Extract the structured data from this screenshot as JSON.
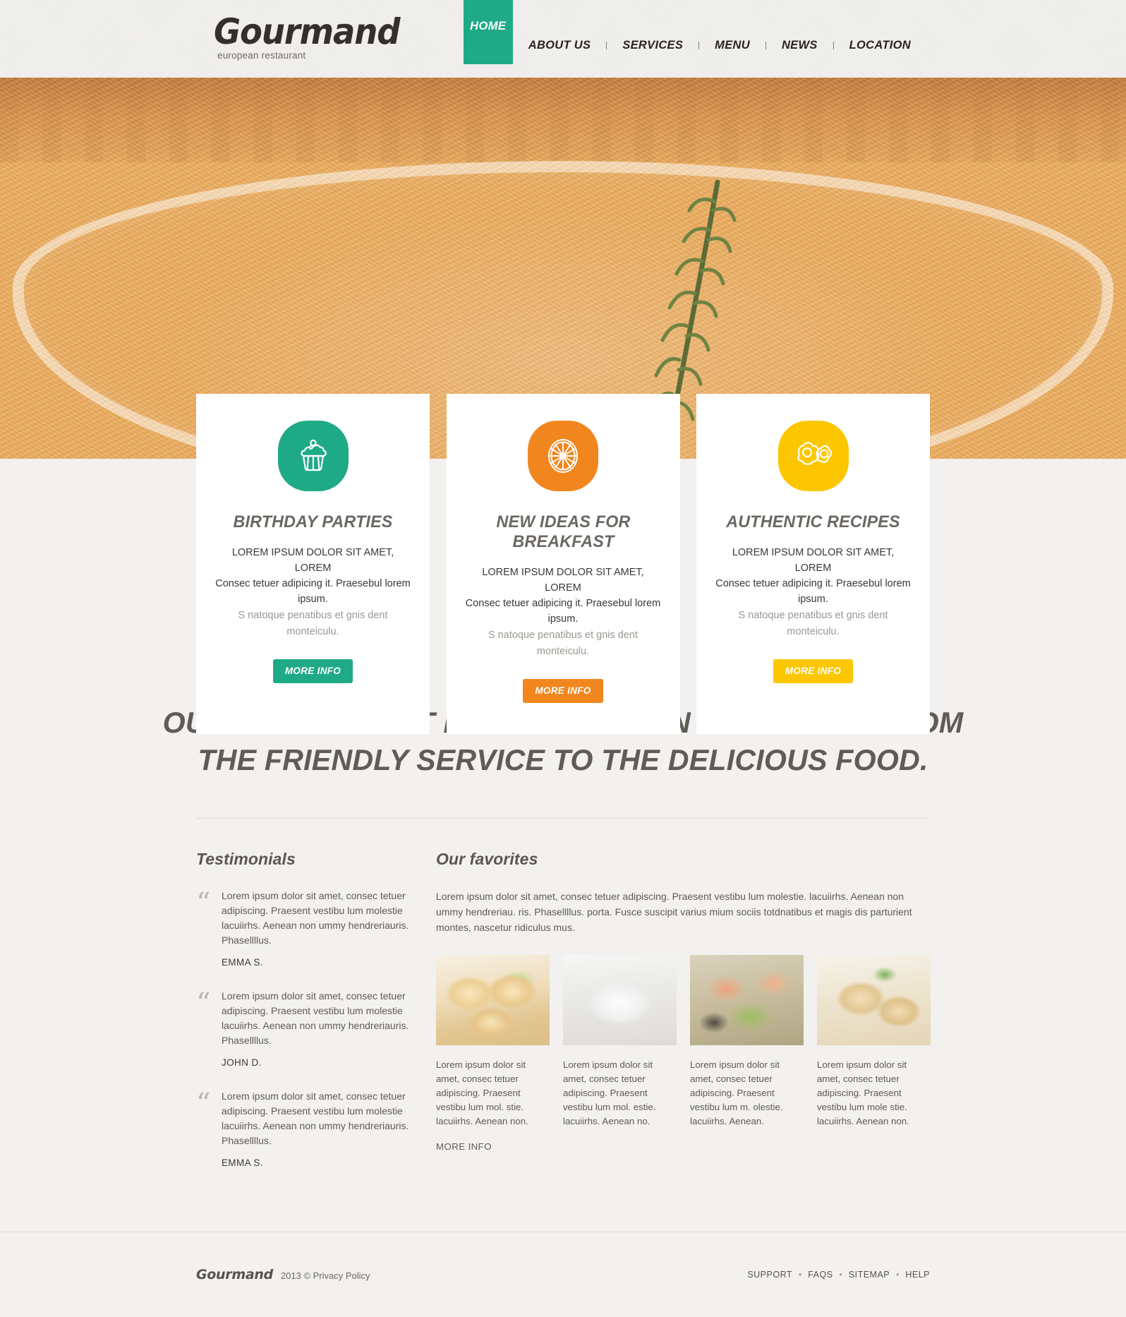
{
  "header": {
    "logo_title": "Gourmand",
    "logo_sub": "european restaurant",
    "nav": {
      "active": "HOME",
      "items": [
        {
          "label": "ABOUT US"
        },
        {
          "label": "SERVICES"
        },
        {
          "label": "MENU"
        },
        {
          "label": "NEWS"
        },
        {
          "label": "LOCATION"
        }
      ]
    }
  },
  "features": [
    {
      "icon": "cupcake-icon",
      "color": "#1faa87",
      "title": "BIRTHDAY PARTIES",
      "line1": "LOREM IPSUM DOLOR SIT AMET, LOREM",
      "line2": "Consec tetuer adipicing it. Praesebul lorem ipsum.",
      "line3": "S natoque penatibus et gnis dent monteiculu.",
      "button": "MORE INFO"
    },
    {
      "icon": "orange-slice-icon",
      "color": "#f2861e",
      "title": "NEW IDEAS FOR BREAKFAST",
      "line1": "LOREM IPSUM DOLOR SIT AMET, LOREM",
      "line2": "Consec tetuer adipicing it. Praesebul lorem ipsum.",
      "line3": "S natoque penatibus et gnis dent monteiculu.",
      "button": "MORE INFO"
    },
    {
      "icon": "fried-eggs-icon",
      "color": "#fcc700",
      "title": "AUTHENTIC RECIPES",
      "line1": "LOREM IPSUM DOLOR SIT AMET, LOREM",
      "line2": "Consec tetuer adipicing it. Praesebul lorem ipsum.",
      "line3": "S natoque penatibus et gnis dent monteiculu.",
      "button": "MORE INFO"
    }
  ],
  "slogan": {
    "line1": "OUR RESTAURANT IS EXCELLENT IN EVERY WAY FROM",
    "line2": "THE  FRIENDLY SERVICE TO THE DELICIOUS FOOD."
  },
  "testimonials": {
    "heading": "Testimonials",
    "items": [
      {
        "text": "Lorem ipsum dolor sit amet, consec tetuer adipiscing. Praesent vestibu lum molestie lacuiirhs. Aenean non ummy  hendreriauris. Phasellllus.",
        "author": "EMMA S."
      },
      {
        "text": "Lorem ipsum dolor sit amet, consec tetuer adipiscing. Praesent vestibu lum molestie lacuiirhs. Aenean non ummy  hendreriauris. Phasellllus.",
        "author": "JOHN D."
      },
      {
        "text": "Lorem ipsum dolor sit amet, consec tetuer adipiscing. Praesent vestibu lum molestie lacuiirhs. Aenean non ummy  hendreriauris. Phasellllus.",
        "author": "EMMA S."
      }
    ]
  },
  "favorites": {
    "heading": "Our favorites",
    "intro": "Lorem ipsum dolor sit amet, consec tetuer adipiscing. Praesent vestibu lum molestie. lacuiirhs. Aenean non ummy hendreriau. ris. Phasellllus. porta. Fusce suscipit varius mium sociis totdnatibus et magis dis parturient montes, nascetur ridiculus mus.",
    "items": [
      {
        "image": "pastry-plate-photo",
        "caption": "Lorem ipsum dolor sit amet, consec tetuer adipiscing. Praesent vestibu lum mol. stie. lacuiirhs. Aenean non."
      },
      {
        "image": "soup-bowl-photo",
        "caption": "Lorem ipsum dolor sit amet, consec tetuer adipiscing. Praesent vestibu lum mol. estie. lacuiirhs. Aenean no."
      },
      {
        "image": "shrimp-salad-photo",
        "caption": "Lorem ipsum dolor sit amet, consec tetuer adipiscing. Praesent vestibu lum m. olestie. lacuiirhs. Aenean."
      },
      {
        "image": "dessert-photo",
        "caption": "Lorem ipsum dolor sit amet, consec tetuer adipiscing. Praesent vestibu lum mole stie. lacuiirhs. Aenean non."
      }
    ],
    "more_label": "MORE INFO"
  },
  "footer": {
    "logo": "Gourmand",
    "copyright": "2013 © Privacy Policy",
    "links": [
      {
        "label": "SUPPORT"
      },
      {
        "label": "FAQS"
      },
      {
        "label": "SITEMAP"
      },
      {
        "label": "HELP"
      }
    ]
  },
  "colors": {
    "teal": "#1faa87",
    "orange": "#f2861e",
    "yellow": "#fcc700",
    "heading_gray": "#5f5c57",
    "paper": "#f3f2f0"
  }
}
